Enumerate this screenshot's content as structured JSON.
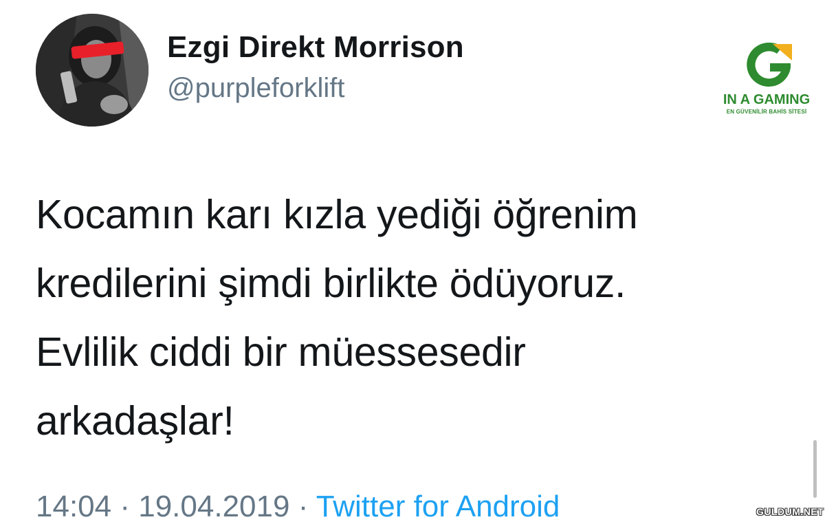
{
  "author": {
    "display_name": "Ezgi Direkt Morrison",
    "handle": "@purpleforklift",
    "avatar_icon": "profile-photo"
  },
  "brand": {
    "name": "IN A GAMING",
    "tagline": "EN GÜVENİLİR BAHİS SİTESİ",
    "green": "#2e8b2f",
    "yellow": "#f2b01e"
  },
  "tweet": {
    "lines": [
      "Kocamın karı kızla yediği öğrenim",
      "kredilerini şimdi birlikte ödüyoruz.",
      "Evlilik ciddi bir müessesedir",
      "arkadaşlar!"
    ]
  },
  "meta": {
    "time": "14:04",
    "separator": "·",
    "date": "19.04.2019",
    "source": "Twitter for Android"
  },
  "watermark": "GULDUM.NET",
  "colors": {
    "text": "#14171a",
    "muted": "#657786",
    "link": "#1da1f2"
  }
}
